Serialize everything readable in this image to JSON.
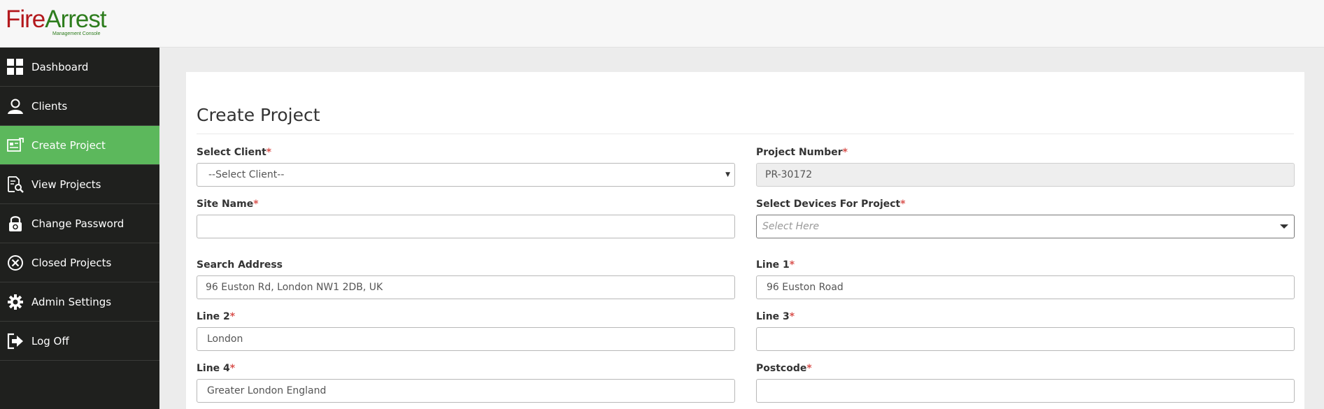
{
  "brand": {
    "name_part1": "Fire",
    "name_part2": "Arrest",
    "subtitle": "Management Console",
    "red": "#b3191d",
    "green": "#2e7d1e"
  },
  "sidebar": {
    "items": [
      {
        "label": "Dashboard",
        "icon": "dashboard-icon"
      },
      {
        "label": "Clients",
        "icon": "user-icon"
      },
      {
        "label": "Create Project",
        "icon": "create-project-icon",
        "active": true
      },
      {
        "label": "View Projects",
        "icon": "view-projects-icon"
      },
      {
        "label": "Change Password",
        "icon": "lock-icon"
      },
      {
        "label": "Closed Projects",
        "icon": "close-circle-icon"
      },
      {
        "label": "Admin Settings",
        "icon": "gear-icon"
      },
      {
        "label": "Log Off",
        "icon": "logout-icon"
      }
    ],
    "active_color": "#5cb85c"
  },
  "main": {
    "title": "Create Project",
    "required_marker": "*",
    "fields": {
      "select_client": {
        "label": "Select Client",
        "value": "--Select Client--"
      },
      "project_number": {
        "label": "Project Number",
        "value": "PR-30172"
      },
      "site_name": {
        "label": "Site Name",
        "value": ""
      },
      "select_devices": {
        "label": "Select Devices For Project",
        "placeholder": "Select Here"
      },
      "search_address": {
        "label": "Search Address",
        "value": "96 Euston Rd, London NW1 2DB, UK"
      },
      "line1": {
        "label": "Line 1",
        "value": "96 Euston Road"
      },
      "line2": {
        "label": "Line 2",
        "value": "London"
      },
      "line3": {
        "label": "Line 3",
        "value": ""
      },
      "line4": {
        "label": "Line 4",
        "value": "Greater London England"
      },
      "postcode": {
        "label": "Postcode",
        "value": ""
      }
    }
  }
}
